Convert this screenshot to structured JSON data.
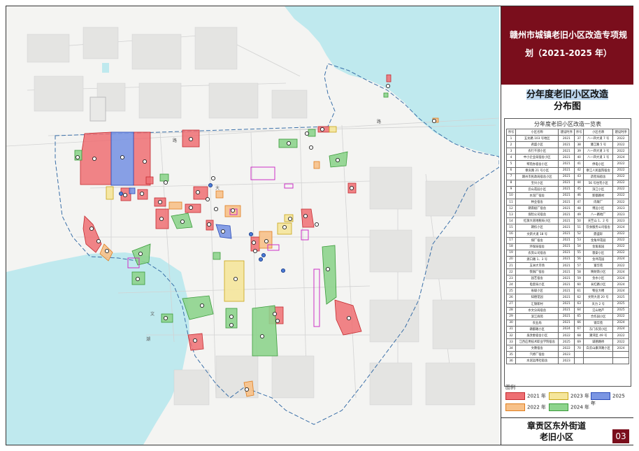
{
  "title": "赣州市城镇老旧小区改造专项规划（2021-2025 年）",
  "title_lines": [
    "赣州市城镇老旧小区改造专项规",
    "划（2021-2025 年）"
  ],
  "subtitle_lines": [
    "分年度老旧小区改造",
    "分布图"
  ],
  "list": {
    "title": "分年度老旧小区改造一览表",
    "headers": [
      "序号",
      "小区名称",
      "建设时序",
      "序号",
      "小区名称",
      "建设时序"
    ],
    "rows": [
      [
        "1",
        "五龙路 103 号地区",
        "2021",
        "37",
        "八一四大道 7 号",
        "2022"
      ],
      [
        "2",
        "君盛小区",
        "2021",
        "38",
        "潘江路 5 号",
        "2022"
      ],
      [
        "3",
        "农行干部小区",
        "2021",
        "39",
        "八一四大道 3 号",
        "2022"
      ],
      [
        "4",
        "中小企业局宿舍小区",
        "2021",
        "40",
        "八一四大道 1 号",
        "2024"
      ],
      [
        "5",
        "琴苑办宿舍小区",
        "2021",
        "41",
        "供电小区",
        "2022"
      ],
      [
        "6",
        "章贡路 21 号小区",
        "2021",
        "42",
        "章江人民医院宿舍",
        "2022"
      ],
      [
        "7",
        "赣州市民政局宿舍小区",
        "2021",
        "43",
        "药检局宿舍",
        "2022"
      ],
      [
        "8",
        "宝兴小区",
        "2021",
        "44",
        "56 号住宅小区",
        "2022"
      ],
      [
        "9",
        "云山花园小区",
        "2021",
        "45",
        "滨江小区",
        "2022"
      ],
      [
        "10",
        "水泥厂宿舍",
        "2021",
        "46",
        "新都路村",
        "2022"
      ],
      [
        "11",
        "林业宿舍",
        "2021",
        "47",
        "肉联厂",
        "2022"
      ],
      [
        "12",
        "赣南极厂宿舍",
        "2021",
        "48",
        "博远小区",
        "2023"
      ],
      [
        "13",
        "保险公司宿舍",
        "2021",
        "49",
        "八一路地厂",
        "2023"
      ],
      [
        "14",
        "红旗大道地税局小区",
        "2021",
        "50",
        "天竺山 1、2 号",
        "2023"
      ],
      [
        "15",
        "赣纺小区",
        "2021",
        "51",
        "饮食服务公司宿舍",
        "2024"
      ],
      [
        "16",
        "文新大道 18 号",
        "2021",
        "52",
        "鼎盛轩",
        "2022"
      ],
      [
        "17",
        "煤厂宿舍",
        "2021",
        "53",
        "金角坪花园",
        "2022"
      ],
      [
        "18",
        "环保局宿舍",
        "2021",
        "54",
        "金角家园",
        "2022"
      ],
      [
        "19",
        "农资公司宿舍",
        "2021",
        "55",
        "蓉安小区",
        "2022"
      ],
      [
        "20",
        "渡口路 1、3 号",
        "2021",
        "56",
        "金坪花园",
        "2024"
      ],
      [
        "21",
        "五洲大市场",
        "2021",
        "57",
        "富华苑",
        "2022"
      ],
      [
        "22",
        "铁锅厂宿舍",
        "2021",
        "58",
        "映财南小区",
        "2024"
      ],
      [
        "23",
        "园艺宿舍",
        "2021",
        "59",
        "金水小区",
        "2024"
      ],
      [
        "24",
        "电瓷局小区",
        "2021",
        "60",
        "长红路小区",
        "2024"
      ],
      [
        "25",
        "省级小区",
        "2021",
        "61",
        "物业大楼",
        "2024"
      ],
      [
        "26",
        "知德花园",
        "2021",
        "62",
        "文明大道 20 号",
        "2025"
      ],
      [
        "27",
        "汇锦新村",
        "2021",
        "63",
        "天力 2 号",
        "2025"
      ],
      [
        "28",
        "水文分局宿舍",
        "2021",
        "64",
        "汪山地产",
        "2025"
      ],
      [
        "29",
        "滨江商苑",
        "2021",
        "65",
        "合作园小区",
        "2022"
      ],
      [
        "30",
        "农业局",
        "2021",
        "66",
        "镜华苑",
        "2024"
      ],
      [
        "31",
        "赣都路小区",
        "2024",
        "67",
        "东门农贸小区",
        "2024"
      ],
      [
        "32",
        "发改委宿舍小区",
        "2022",
        "68",
        "潮湾区 49 号",
        "2022"
      ],
      [
        "33",
        "江西应用技术职业学院宿舍",
        "2025",
        "69",
        "诚德路桥",
        "2022"
      ],
      [
        "34",
        "文教宿舍",
        "2022",
        "70",
        "白云山康泽路小区",
        "2024"
      ],
      [
        "35",
        "汽修厂宿舍",
        "2023",
        "",
        "",
        ""
      ],
      [
        "36",
        "水泥运用社宿舍",
        "2023",
        "",
        "",
        ""
      ]
    ]
  },
  "legend": {
    "title": "图例",
    "items": [
      {
        "label": "2021 年",
        "fill": "#ee6f73",
        "stroke": "#c42a2f"
      },
      {
        "label": "2023 年",
        "fill": "#f5e69b",
        "stroke": "#c9a616"
      },
      {
        "label": "2025 年",
        "fill": "#7b96e3",
        "stroke": "#2a4bb8"
      },
      {
        "label": "2022 年",
        "fill": "#f7c189",
        "stroke": "#e07e1e"
      },
      {
        "label": "2024 年",
        "fill": "#8ed48d",
        "stroke": "#3a9b3a"
      }
    ]
  },
  "footer_lines": [
    "章贡区东外街道",
    "老旧小区"
  ],
  "page_number": "03",
  "colors": {
    "accent": "#7a0e1c",
    "river": "#bfe9ee",
    "y2021": "#ee6f73",
    "y2022": "#f7c189",
    "y2023": "#f5e69b",
    "y2024": "#8ed48d",
    "y2025": "#7b96e3",
    "planned_outline": "#cc2fc7",
    "boundary": "#3a6fa8"
  },
  "map_labels": [
    "城",
    "路",
    "路",
    "大",
    "大",
    "文",
    "潮"
  ]
}
